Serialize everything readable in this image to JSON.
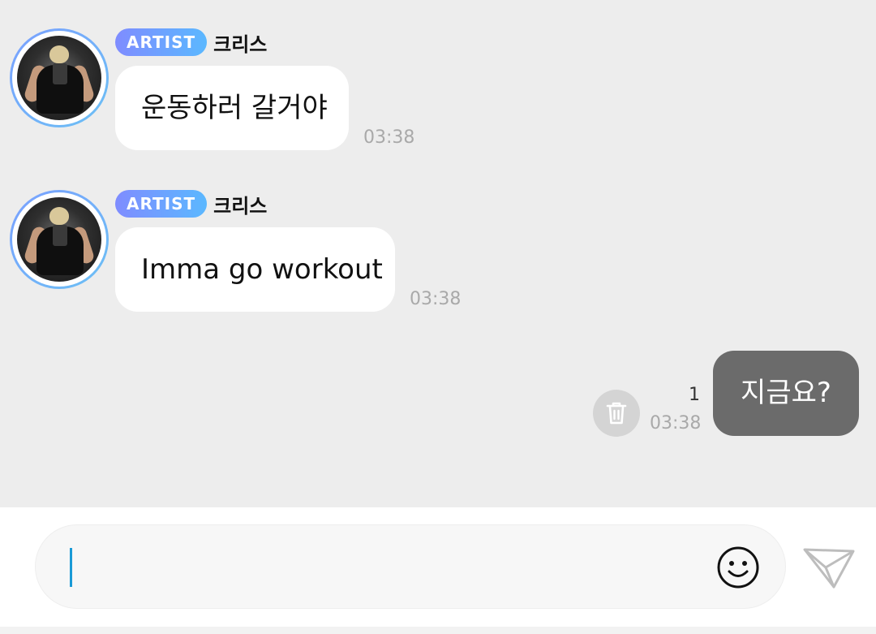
{
  "messages_in": [
    {
      "badge": "ARTIST",
      "sender": "크리스",
      "text": "운동하러 갈거야",
      "time": "03:38"
    },
    {
      "badge": "ARTIST",
      "sender": "크리스",
      "text": "Imma go workout",
      "time": "03:38"
    }
  ],
  "message_out": {
    "text": "지금요?",
    "unread": "1",
    "time": "03:38"
  },
  "icons": {
    "delete": "trash-icon",
    "emoji": "smiley-icon",
    "send": "paper-plane-icon"
  },
  "colors": {
    "chat_bg": "#ededed",
    "bubble_in": "#ffffff",
    "bubble_out": "#6b6b6b",
    "badge_gradient_start": "#7f8cff",
    "badge_gradient_end": "#5bb8ff",
    "caret": "#1a9ad6"
  }
}
